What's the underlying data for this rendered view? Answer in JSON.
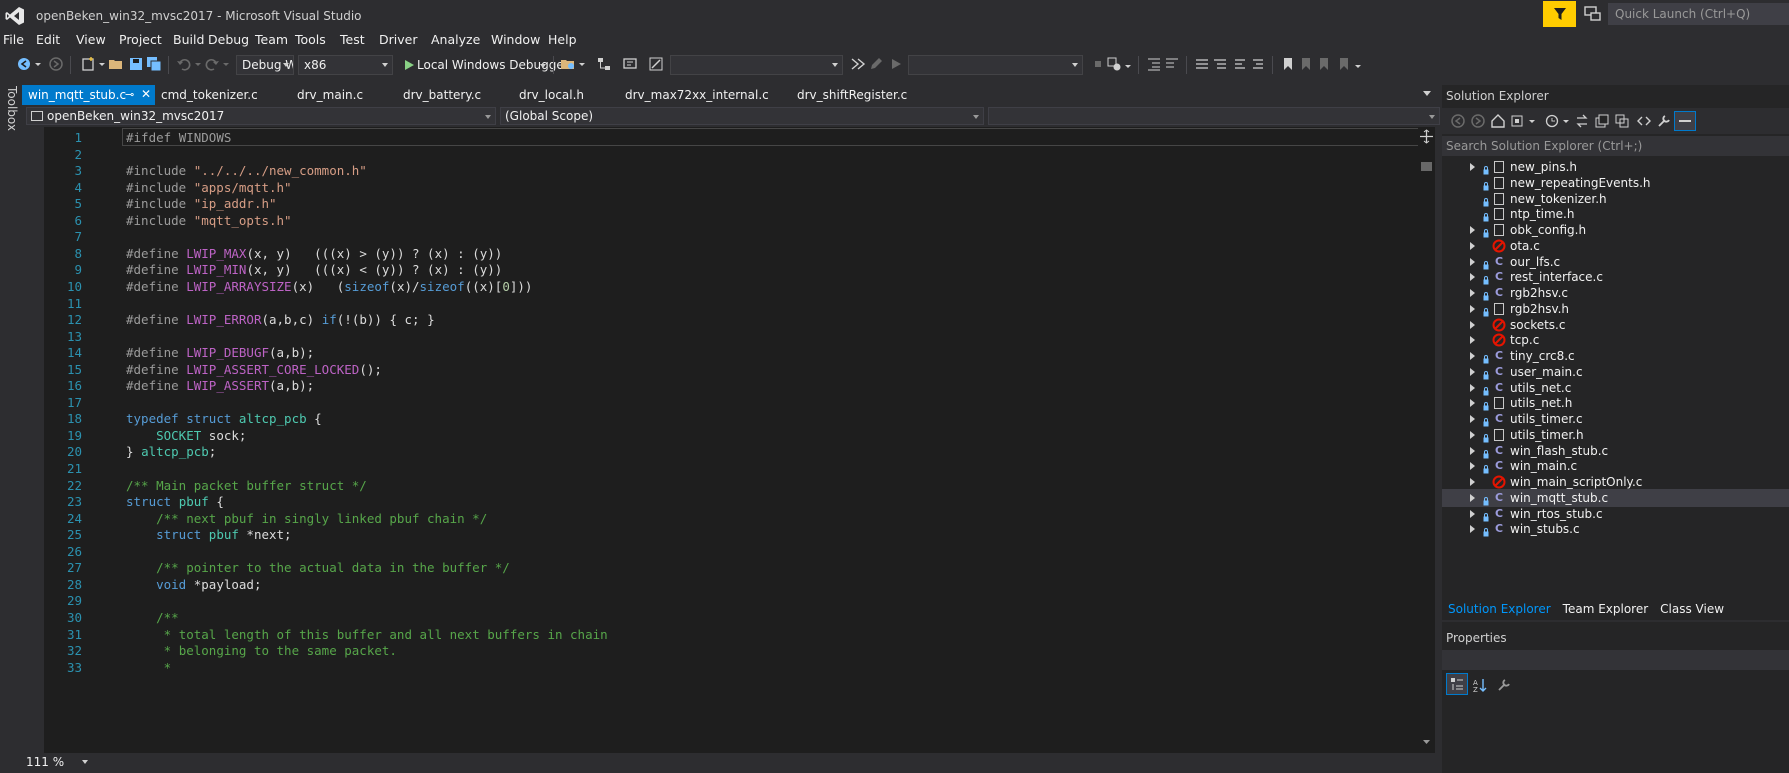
{
  "window": {
    "title": "openBeken_win32_mvsc2017 - Microsoft Visual Studio",
    "quick_launch_placeholder": "Quick Launch (Ctrl+Q)"
  },
  "menu": [
    "File",
    "Edit",
    "View",
    "Project",
    "Build",
    "Debug",
    "Team",
    "Tools",
    "Test",
    "Driver",
    "Analyze",
    "Window",
    "Help"
  ],
  "toolbar": {
    "config": "Debug W",
    "platform": "x86",
    "debugger_label": "Local Windows Debugger",
    "combo_a": "",
    "combo_b": ""
  },
  "toolbox_label": "Toolbox",
  "tabs": [
    {
      "label": "win_mqtt_stub.c",
      "active": true
    },
    {
      "label": "cmd_tokenizer.c",
      "active": false
    },
    {
      "label": "drv_main.c",
      "active": false
    },
    {
      "label": "drv_battery.c",
      "active": false
    },
    {
      "label": "drv_local.h",
      "active": false
    },
    {
      "label": "drv_max72xx_internal.c",
      "active": false
    },
    {
      "label": "drv_shiftRegister.c",
      "active": false
    }
  ],
  "navbar": {
    "project": "openBeken_win32_mvsc2017",
    "scope": "(Global Scope)",
    "member": ""
  },
  "editor": {
    "zoom": "111 %",
    "lines": [
      [
        [
          "pp",
          "#ifdef "
        ],
        [
          "inactive",
          "WINDOWS"
        ]
      ],
      [],
      [
        [
          "pp",
          "#include "
        ],
        [
          "str",
          "\"../../../new_common.h\""
        ]
      ],
      [
        [
          "pp",
          "#include "
        ],
        [
          "str",
          "\"apps/mqtt.h\""
        ]
      ],
      [
        [
          "pp",
          "#include "
        ],
        [
          "str",
          "\"ip_addr.h\""
        ]
      ],
      [
        [
          "pp",
          "#include "
        ],
        [
          "str",
          "\"mqtt_opts.h\""
        ]
      ],
      [],
      [
        [
          "pp",
          "#define "
        ],
        [
          "macro",
          "LWIP_MAX"
        ],
        [
          "txt",
          "(x, y)   (((x) > (y)) ? (x) : (y))"
        ]
      ],
      [
        [
          "pp",
          "#define "
        ],
        [
          "macro",
          "LWIP_MIN"
        ],
        [
          "txt",
          "(x, y)   (((x) < (y)) ? (x) : (y))"
        ]
      ],
      [
        [
          "pp",
          "#define "
        ],
        [
          "macro",
          "LWIP_ARRAYSIZE"
        ],
        [
          "txt",
          "(x)   ("
        ],
        [
          "kw",
          "sizeof"
        ],
        [
          "txt",
          "(x)/"
        ],
        [
          "kw",
          "sizeof"
        ],
        [
          "txt",
          "((x)["
        ],
        [
          "num",
          "0"
        ],
        [
          "txt",
          "]))"
        ]
      ],
      [],
      [
        [
          "pp",
          "#define "
        ],
        [
          "macro",
          "LWIP_ERROR"
        ],
        [
          "txt",
          "(a,b,c) "
        ],
        [
          "kw",
          "if"
        ],
        [
          "txt",
          "(!(b)) { c; }"
        ]
      ],
      [],
      [
        [
          "pp",
          "#define "
        ],
        [
          "macro",
          "LWIP_DEBUGF"
        ],
        [
          "txt",
          "(a,b);"
        ]
      ],
      [
        [
          "pp",
          "#define "
        ],
        [
          "macro",
          "LWIP_ASSERT_CORE_LOCKED"
        ],
        [
          "txt",
          "();"
        ]
      ],
      [
        [
          "pp",
          "#define "
        ],
        [
          "macro",
          "LWIP_ASSERT"
        ],
        [
          "txt",
          "(a,b);"
        ]
      ],
      [],
      [
        [
          "kw",
          "typedef "
        ],
        [
          "kw",
          "struct "
        ],
        [
          "type",
          "altcp_pcb"
        ],
        [
          "txt",
          " {"
        ]
      ],
      [
        [
          "txt",
          "    "
        ],
        [
          "type",
          "SOCKET"
        ],
        [
          "txt",
          " sock;"
        ]
      ],
      [
        [
          "txt",
          "} "
        ],
        [
          "type",
          "altcp_pcb"
        ],
        [
          "txt",
          ";"
        ]
      ],
      [],
      [
        [
          "com",
          "/** Main packet buffer struct */"
        ]
      ],
      [
        [
          "kw",
          "struct "
        ],
        [
          "type",
          "pbuf"
        ],
        [
          "txt",
          " {"
        ]
      ],
      [
        [
          "txt",
          "    "
        ],
        [
          "com",
          "/** next pbuf in singly linked pbuf chain */"
        ]
      ],
      [
        [
          "txt",
          "    "
        ],
        [
          "kw",
          "struct "
        ],
        [
          "type",
          "pbuf"
        ],
        [
          "txt",
          " *next;"
        ]
      ],
      [],
      [
        [
          "txt",
          "    "
        ],
        [
          "com",
          "/** pointer to the actual data in the buffer */"
        ]
      ],
      [
        [
          "txt",
          "    "
        ],
        [
          "kw",
          "void"
        ],
        [
          "txt",
          " *payload;"
        ]
      ],
      [],
      [
        [
          "txt",
          "    "
        ],
        [
          "com",
          "/**"
        ]
      ],
      [
        [
          "txt",
          "     "
        ],
        [
          "com",
          "* total length of this buffer and all next buffers in chain"
        ]
      ],
      [
        [
          "txt",
          "     "
        ],
        [
          "com",
          "* belonging to the same packet."
        ]
      ],
      [
        [
          "txt",
          "     "
        ],
        [
          "com",
          "*"
        ]
      ]
    ]
  },
  "solution_explorer": {
    "title": "Solution Explorer",
    "search_placeholder": "Search Solution Explorer (Ctrl+;)",
    "items": [
      {
        "label": "new_pins.h",
        "kind": "h",
        "arrow": true
      },
      {
        "label": "new_repeatingEvents.h",
        "kind": "h",
        "arrow": false
      },
      {
        "label": "new_tokenizer.h",
        "kind": "h",
        "arrow": false
      },
      {
        "label": "ntp_time.h",
        "kind": "h",
        "arrow": false
      },
      {
        "label": "obk_config.h",
        "kind": "h",
        "arrow": true
      },
      {
        "label": "ota.c",
        "kind": "err",
        "arrow": true
      },
      {
        "label": "our_lfs.c",
        "kind": "c",
        "arrow": true
      },
      {
        "label": "rest_interface.c",
        "kind": "c",
        "arrow": true
      },
      {
        "label": "rgb2hsv.c",
        "kind": "c",
        "arrow": true
      },
      {
        "label": "rgb2hsv.h",
        "kind": "h",
        "arrow": true
      },
      {
        "label": "sockets.c",
        "kind": "err",
        "arrow": true
      },
      {
        "label": "tcp.c",
        "kind": "err",
        "arrow": true
      },
      {
        "label": "tiny_crc8.c",
        "kind": "c",
        "arrow": true
      },
      {
        "label": "user_main.c",
        "kind": "c",
        "arrow": true
      },
      {
        "label": "utils_net.c",
        "kind": "c",
        "arrow": true
      },
      {
        "label": "utils_net.h",
        "kind": "h",
        "arrow": true
      },
      {
        "label": "utils_timer.c",
        "kind": "c",
        "arrow": true
      },
      {
        "label": "utils_timer.h",
        "kind": "h",
        "arrow": true
      },
      {
        "label": "win_flash_stub.c",
        "kind": "c",
        "arrow": true
      },
      {
        "label": "win_main.c",
        "kind": "c",
        "arrow": true
      },
      {
        "label": "win_main_scriptOnly.c",
        "kind": "err",
        "arrow": true
      },
      {
        "label": "win_mqtt_stub.c",
        "kind": "c",
        "arrow": true,
        "selected": true
      },
      {
        "label": "win_rtos_stub.c",
        "kind": "c",
        "arrow": true
      },
      {
        "label": "win_stubs.c",
        "kind": "c",
        "arrow": true
      }
    ],
    "tabs": [
      "Solution Explorer",
      "Team Explorer",
      "Class View"
    ]
  },
  "properties": {
    "title": "Properties"
  },
  "colors": {
    "accent": "#007acc",
    "filter_button": "#ffcc00",
    "error_icon": "#e51400"
  }
}
